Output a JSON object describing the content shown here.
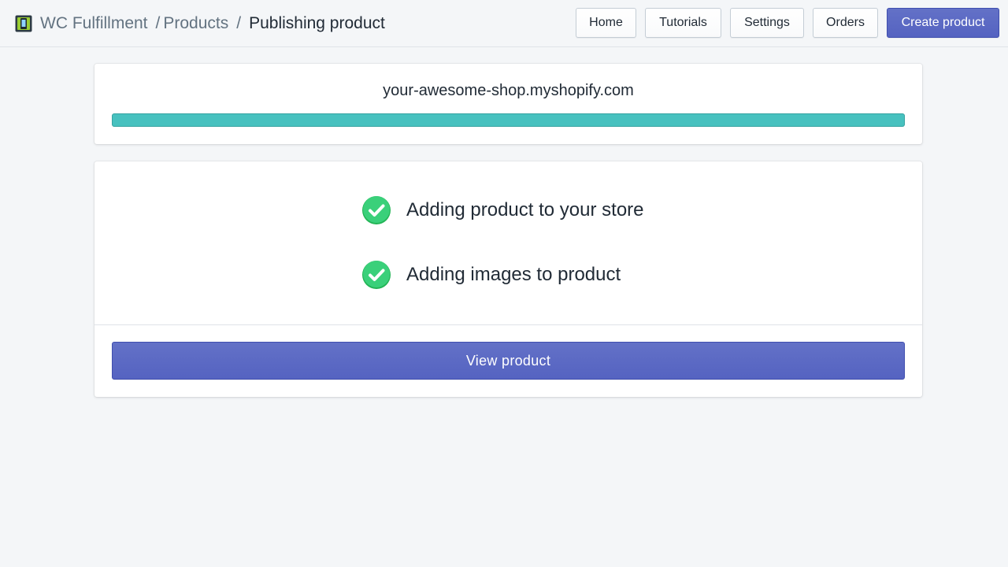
{
  "breadcrumb": {
    "app_name": "WC Fulfillment",
    "separator_1": "/",
    "section": "Products",
    "separator_2": "/",
    "current": "Publishing product"
  },
  "nav": {
    "home": "Home",
    "tutorials": "Tutorials",
    "settings": "Settings",
    "orders": "Orders",
    "create_product": "Create product"
  },
  "shop": {
    "domain": "your-awesome-shop.myshopify.com",
    "progress_percent": 100
  },
  "steps": [
    {
      "label": "Adding product to your store",
      "status": "complete",
      "icon": "check-circle-icon"
    },
    {
      "label": "Adding images to product",
      "status": "complete",
      "icon": "check-circle-icon"
    }
  ],
  "actions": {
    "view_product": "View product"
  },
  "colors": {
    "accent": "#5c6ac4",
    "progress": "#47c1bf",
    "success": "#2ecc71"
  }
}
